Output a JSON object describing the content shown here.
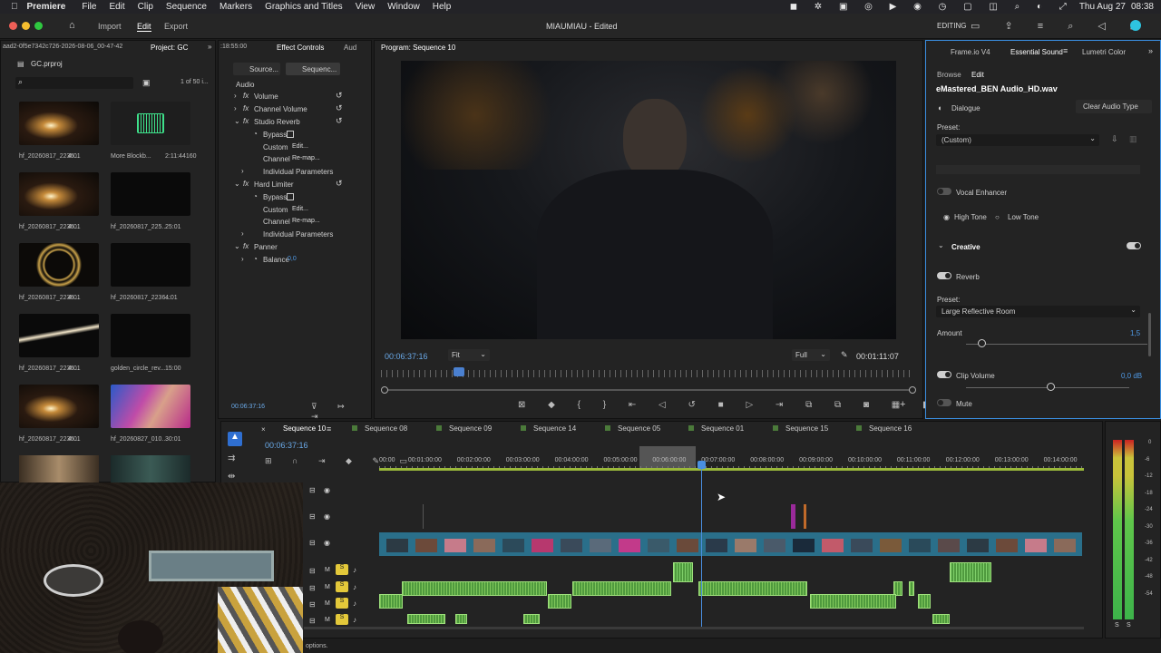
{
  "menubar": {
    "app": "Premiere",
    "items": [
      "File",
      "Edit",
      "Clip",
      "Sequence",
      "Markers",
      "Graphics and Titles",
      "View",
      "Window",
      "Help"
    ],
    "status": {
      "editing": "EDITING",
      "date": "Thu Aug 27",
      "time": "08:38"
    }
  },
  "titlebar": {
    "title": "MIAUMIAU - Edited",
    "nav": [
      "Import",
      "Edit",
      "Export"
    ]
  },
  "project": {
    "path": "aad2-0f5e7342c726-2026-08-06_00-47-42",
    "tab": "Project: GC",
    "file": "GC.prproj",
    "count": "1 of 50 i...",
    "items": [
      {
        "name": "hf_20260817_2236...",
        "dur": "4:01"
      },
      {
        "name": "More Blockb...",
        "dur": "2:11:44160"
      },
      {
        "name": "hf_20260817_2236...",
        "dur": "4:01"
      },
      {
        "name": "hf_20260817_225...",
        "dur": "25:01"
      },
      {
        "name": "hf_20260817_2236...",
        "dur": "4:01"
      },
      {
        "name": "hf_20260817_2236...",
        "dur": "4:01"
      },
      {
        "name": "hf_20260817_2236...",
        "dur": "4:01"
      },
      {
        "name": "golden_circle_rev...",
        "dur": "15:00"
      },
      {
        "name": "hf_20260817_2236...",
        "dur": "4:01"
      },
      {
        "name": "hf_20260827_010...",
        "dur": "30:01"
      }
    ]
  },
  "effects": {
    "timecode_top": ":18:55:00",
    "tab": "Effect Controls",
    "tab2": "Aud",
    "source": "Source...",
    "sequence": "Sequenc...",
    "section": "Audio",
    "rows": [
      "Volume",
      "Channel Volume",
      "Studio Reverb",
      "Bypass",
      "Custom",
      "Channel",
      "Individual Parameters",
      "Hard Limiter",
      "Bypass",
      "Custom",
      "Channel",
      "Individual Parameters",
      "Panner",
      "Balance"
    ],
    "custom_val": "Edit...",
    "channel_val": "Re-map...",
    "balance_val": "0,0",
    "timecode": "00:06:37:16"
  },
  "program": {
    "title": "Program: Sequence 10",
    "timecode": "00:06:37:16",
    "fit": "Fit",
    "full": "Full",
    "duration": "00:01:11:07"
  },
  "rightpanel": {
    "tabs": [
      "Frame.io V4",
      "Essential Sound",
      "Lumetri Color"
    ],
    "sub": [
      "Browse",
      "Edit"
    ],
    "file": "eMastered_BEN Audio_HD.wav",
    "type": "Dialogue",
    "clear": "Clear Audio Type",
    "preset_label": "Preset:",
    "preset": "(Custom)",
    "vocal": "Vocal Enhancer",
    "high": "High Tone",
    "low": "Low Tone",
    "creative": "Creative",
    "reverb": "Reverb",
    "preset2_label": "Preset:",
    "preset2": "Large Reflective Room",
    "amount": "Amount",
    "amount_val": "1,5",
    "amount_level": 0.07,
    "clipvol": "Clip Volume",
    "clipvol_val": "0,0 dB",
    "clipvol_level": 0.5,
    "mute": "Mute"
  },
  "timeline": {
    "tabs": [
      "Sequence 10",
      "Sequence 08",
      "Sequence 09",
      "Sequence 14",
      "Sequence 05",
      "Sequence 01",
      "Sequence 15",
      "Sequence 16"
    ],
    "timecode": "00:06:37:16",
    "ruler": [
      "00:00",
      "00:01:00:00",
      "00:02:00:00",
      "00:03:00:00",
      "00:04:00:00",
      "00:05:00:00",
      "00:06:00:00",
      "00:07:00:00",
      "00:08:00:00",
      "00:09:00:00",
      "00:10:00:00",
      "00:11:00:00",
      "00:12:00:00",
      "00:13:00:00",
      "00:14:00:00"
    ]
  },
  "meter": {
    "ticks": [
      "0",
      "-6",
      "-12",
      "-18",
      "-24",
      "-30",
      "-36",
      "-42",
      "-48",
      "-54"
    ],
    "s": "S",
    "s2": "S"
  },
  "status": "options."
}
